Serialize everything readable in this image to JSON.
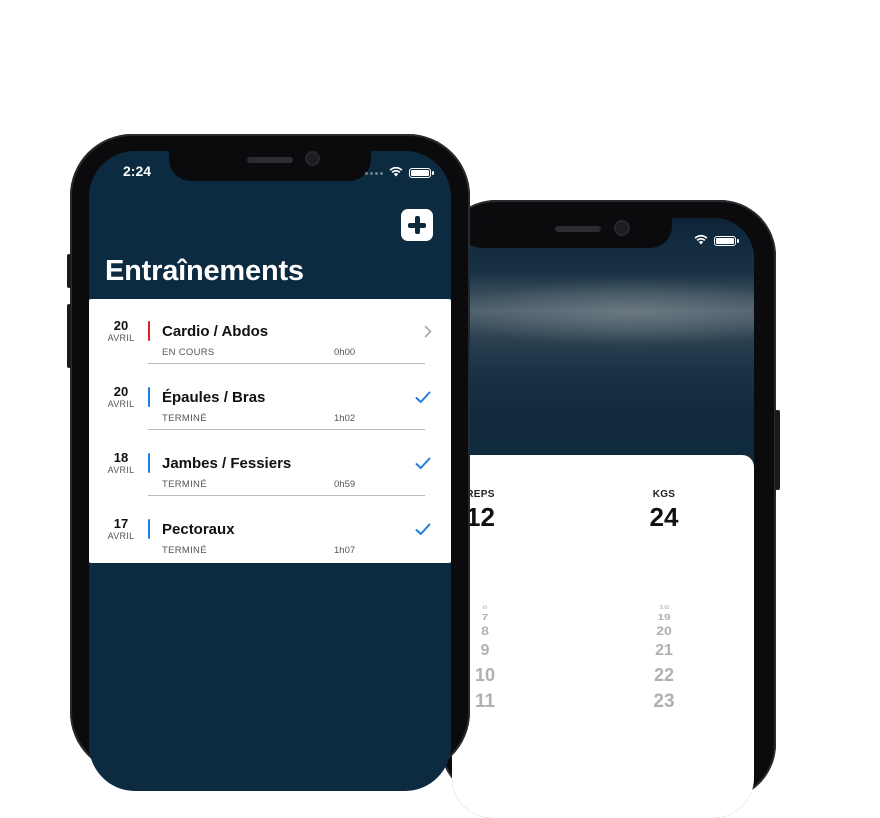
{
  "colors": {
    "background": "#0c2a40",
    "in_progress": "#e0202a",
    "done": "#1f7ee0",
    "card": "#ffffff"
  },
  "status_bar": {
    "time": "2:24"
  },
  "header": {
    "title": "Entraînements",
    "add_icon": "plus-icon"
  },
  "workouts": [
    {
      "day": "20",
      "month": "AVRIL",
      "name": "Cardio / Abdos",
      "status": "EN COURS",
      "duration": "0h00",
      "state": "in_progress",
      "trailing_icon": "chevron-right-icon"
    },
    {
      "day": "20",
      "month": "AVRIL",
      "name": "Épaules / Bras",
      "status": "TERMINÉ",
      "duration": "1h02",
      "state": "done",
      "trailing_icon": "checkmark-icon"
    },
    {
      "day": "18",
      "month": "AVRIL",
      "name": "Jambes / Fessiers",
      "status": "TERMINÉ",
      "duration": "0h59",
      "state": "done",
      "trailing_icon": "checkmark-icon"
    },
    {
      "day": "17",
      "month": "AVRIL",
      "name": "Pectoraux",
      "status": "TERMINÉ",
      "duration": "1h07",
      "state": "done",
      "trailing_icon": "checkmark-icon"
    }
  ],
  "picker": {
    "reps": {
      "label": "REPS",
      "value": "12",
      "wheel": [
        "6",
        "7",
        "8",
        "9",
        "10",
        "11"
      ]
    },
    "kgs": {
      "label": "KGS",
      "value": "24",
      "wheel": [
        "18",
        "19",
        "20",
        "21",
        "22",
        "23"
      ]
    }
  }
}
